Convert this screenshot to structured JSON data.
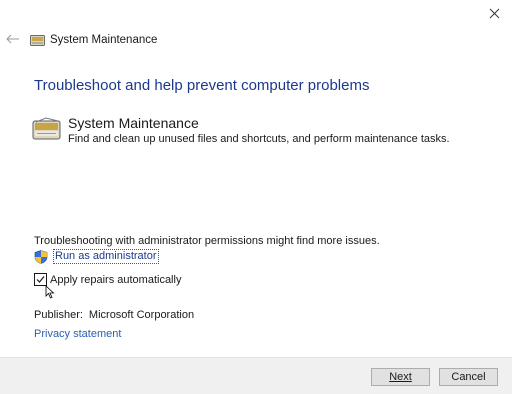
{
  "window": {
    "title": "System Maintenance"
  },
  "icons": {
    "close": "close-icon",
    "back": "back-arrow-icon",
    "title": "system-maintenance-icon",
    "troubleshooter": "system-maintenance-icon",
    "shield": "uac-shield-icon",
    "cursor": "mouse-cursor-icon"
  },
  "main": {
    "heading": "Troubleshoot and help prevent computer problems",
    "troubleshooter": {
      "name": "System Maintenance",
      "description": "Find and clean up unused files and shortcuts, and perform maintenance tasks."
    },
    "admin_note": "Troubleshooting with administrator permissions might find more issues.",
    "run_as_admin_label": "Run as administrator",
    "apply_repairs": {
      "label": "Apply repairs automatically",
      "checked": true
    },
    "publisher_label": "Publisher:",
    "publisher_value": "Microsoft Corporation",
    "privacy_link": "Privacy statement"
  },
  "footer": {
    "next_label": "Next",
    "cancel_label": "Cancel"
  },
  "colors": {
    "heading": "#1b3a8c",
    "link": "#2a5fb0",
    "footer_bg": "#f0f0f0",
    "button_bg": "#e1e1e1",
    "button_border": "#adadad"
  }
}
